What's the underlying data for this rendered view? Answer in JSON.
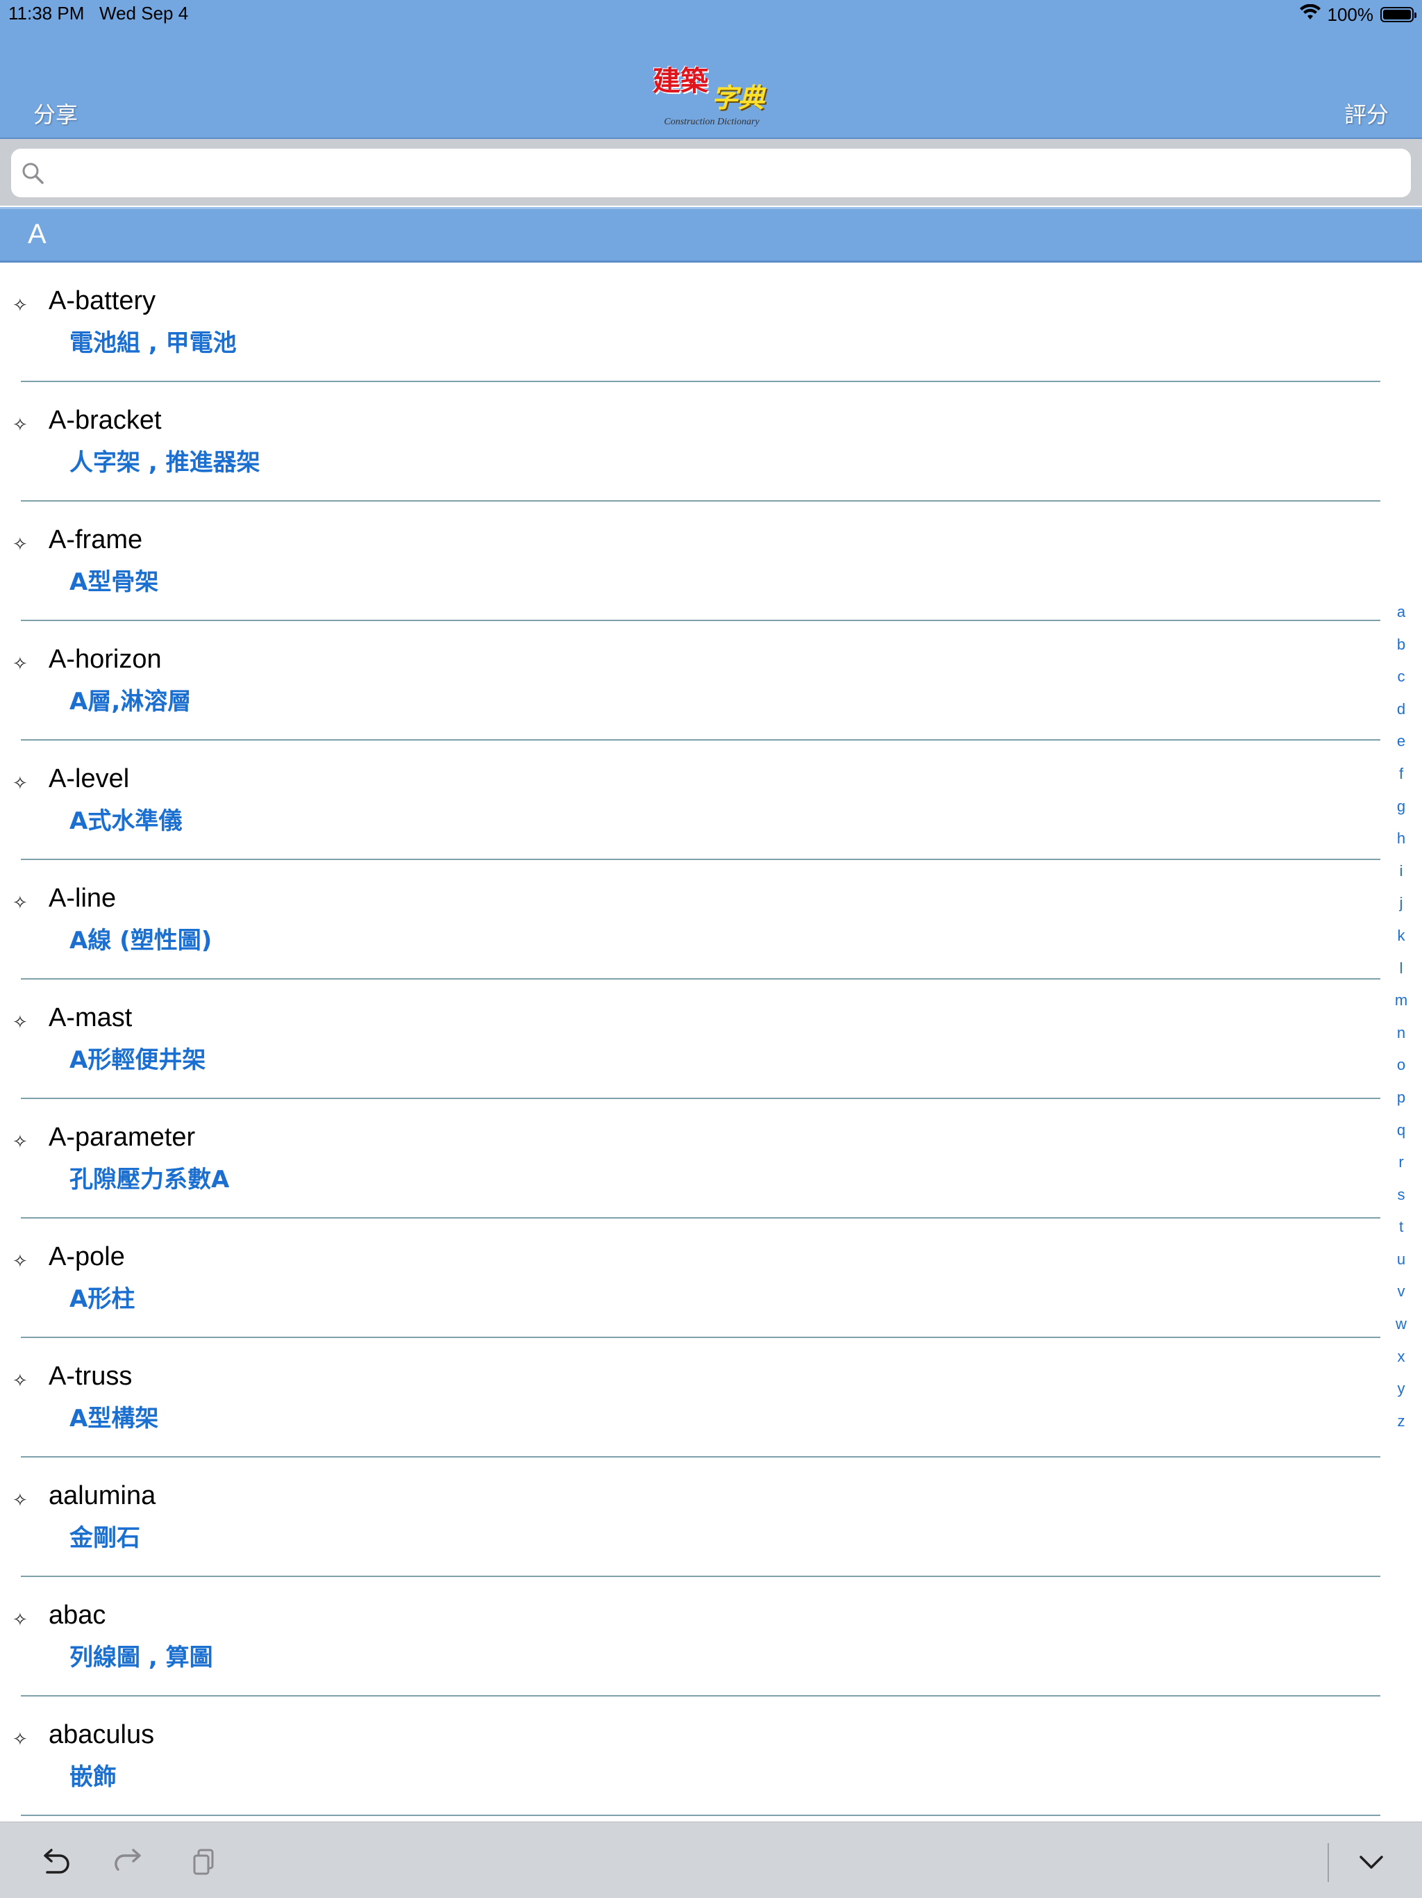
{
  "status_bar": {
    "time": "11:38 PM   Wed Sep 4",
    "battery": "100%"
  },
  "nav": {
    "left_label": "分享",
    "right_label": "評分",
    "logo_line1": "建築",
    "logo_line2": "字典",
    "logo_subtitle": "Construction Dictionary"
  },
  "search": {
    "value": "",
    "placeholder": ""
  },
  "section": {
    "title": "A"
  },
  "entries": [
    {
      "term": "A-battery",
      "translation": "電池組 , 甲電池"
    },
    {
      "term": "A-bracket",
      "translation": "人字架 , 推進器架"
    },
    {
      "term": "A-frame",
      "translation": "A型骨架"
    },
    {
      "term": "A-horizon",
      "translation": "A層,淋溶層"
    },
    {
      "term": "A-level",
      "translation": "A式水準儀"
    },
    {
      "term": "A-line",
      "translation": "A線 (塑性圖)"
    },
    {
      "term": "A-mast",
      "translation": "A形輕便井架"
    },
    {
      "term": "A-parameter",
      "translation": "孔隙壓力系數A"
    },
    {
      "term": "A-pole",
      "translation": "A形柱"
    },
    {
      "term": "A-truss",
      "translation": "A型構架"
    },
    {
      "term": "aalumina",
      "translation": "金剛石"
    },
    {
      "term": "abac",
      "translation": "列線圖 , 算圖"
    },
    {
      "term": "abaculus",
      "translation": "嵌飾"
    }
  ],
  "index_letters": [
    "a",
    "b",
    "c",
    "d",
    "e",
    "f",
    "g",
    "h",
    "i",
    "j",
    "k",
    "l",
    "m",
    "n",
    "o",
    "p",
    "q",
    "r",
    "s",
    "t",
    "u",
    "v",
    "w",
    "x",
    "y",
    "z"
  ],
  "colors": {
    "nav_bar": "#74a6e0",
    "translation_text": "#1b6fd1",
    "separator": "#7ea0a8"
  },
  "toolbar_icons": [
    "undo-icon",
    "redo-icon",
    "paste-icon",
    "hide-keyboard-icon"
  ]
}
